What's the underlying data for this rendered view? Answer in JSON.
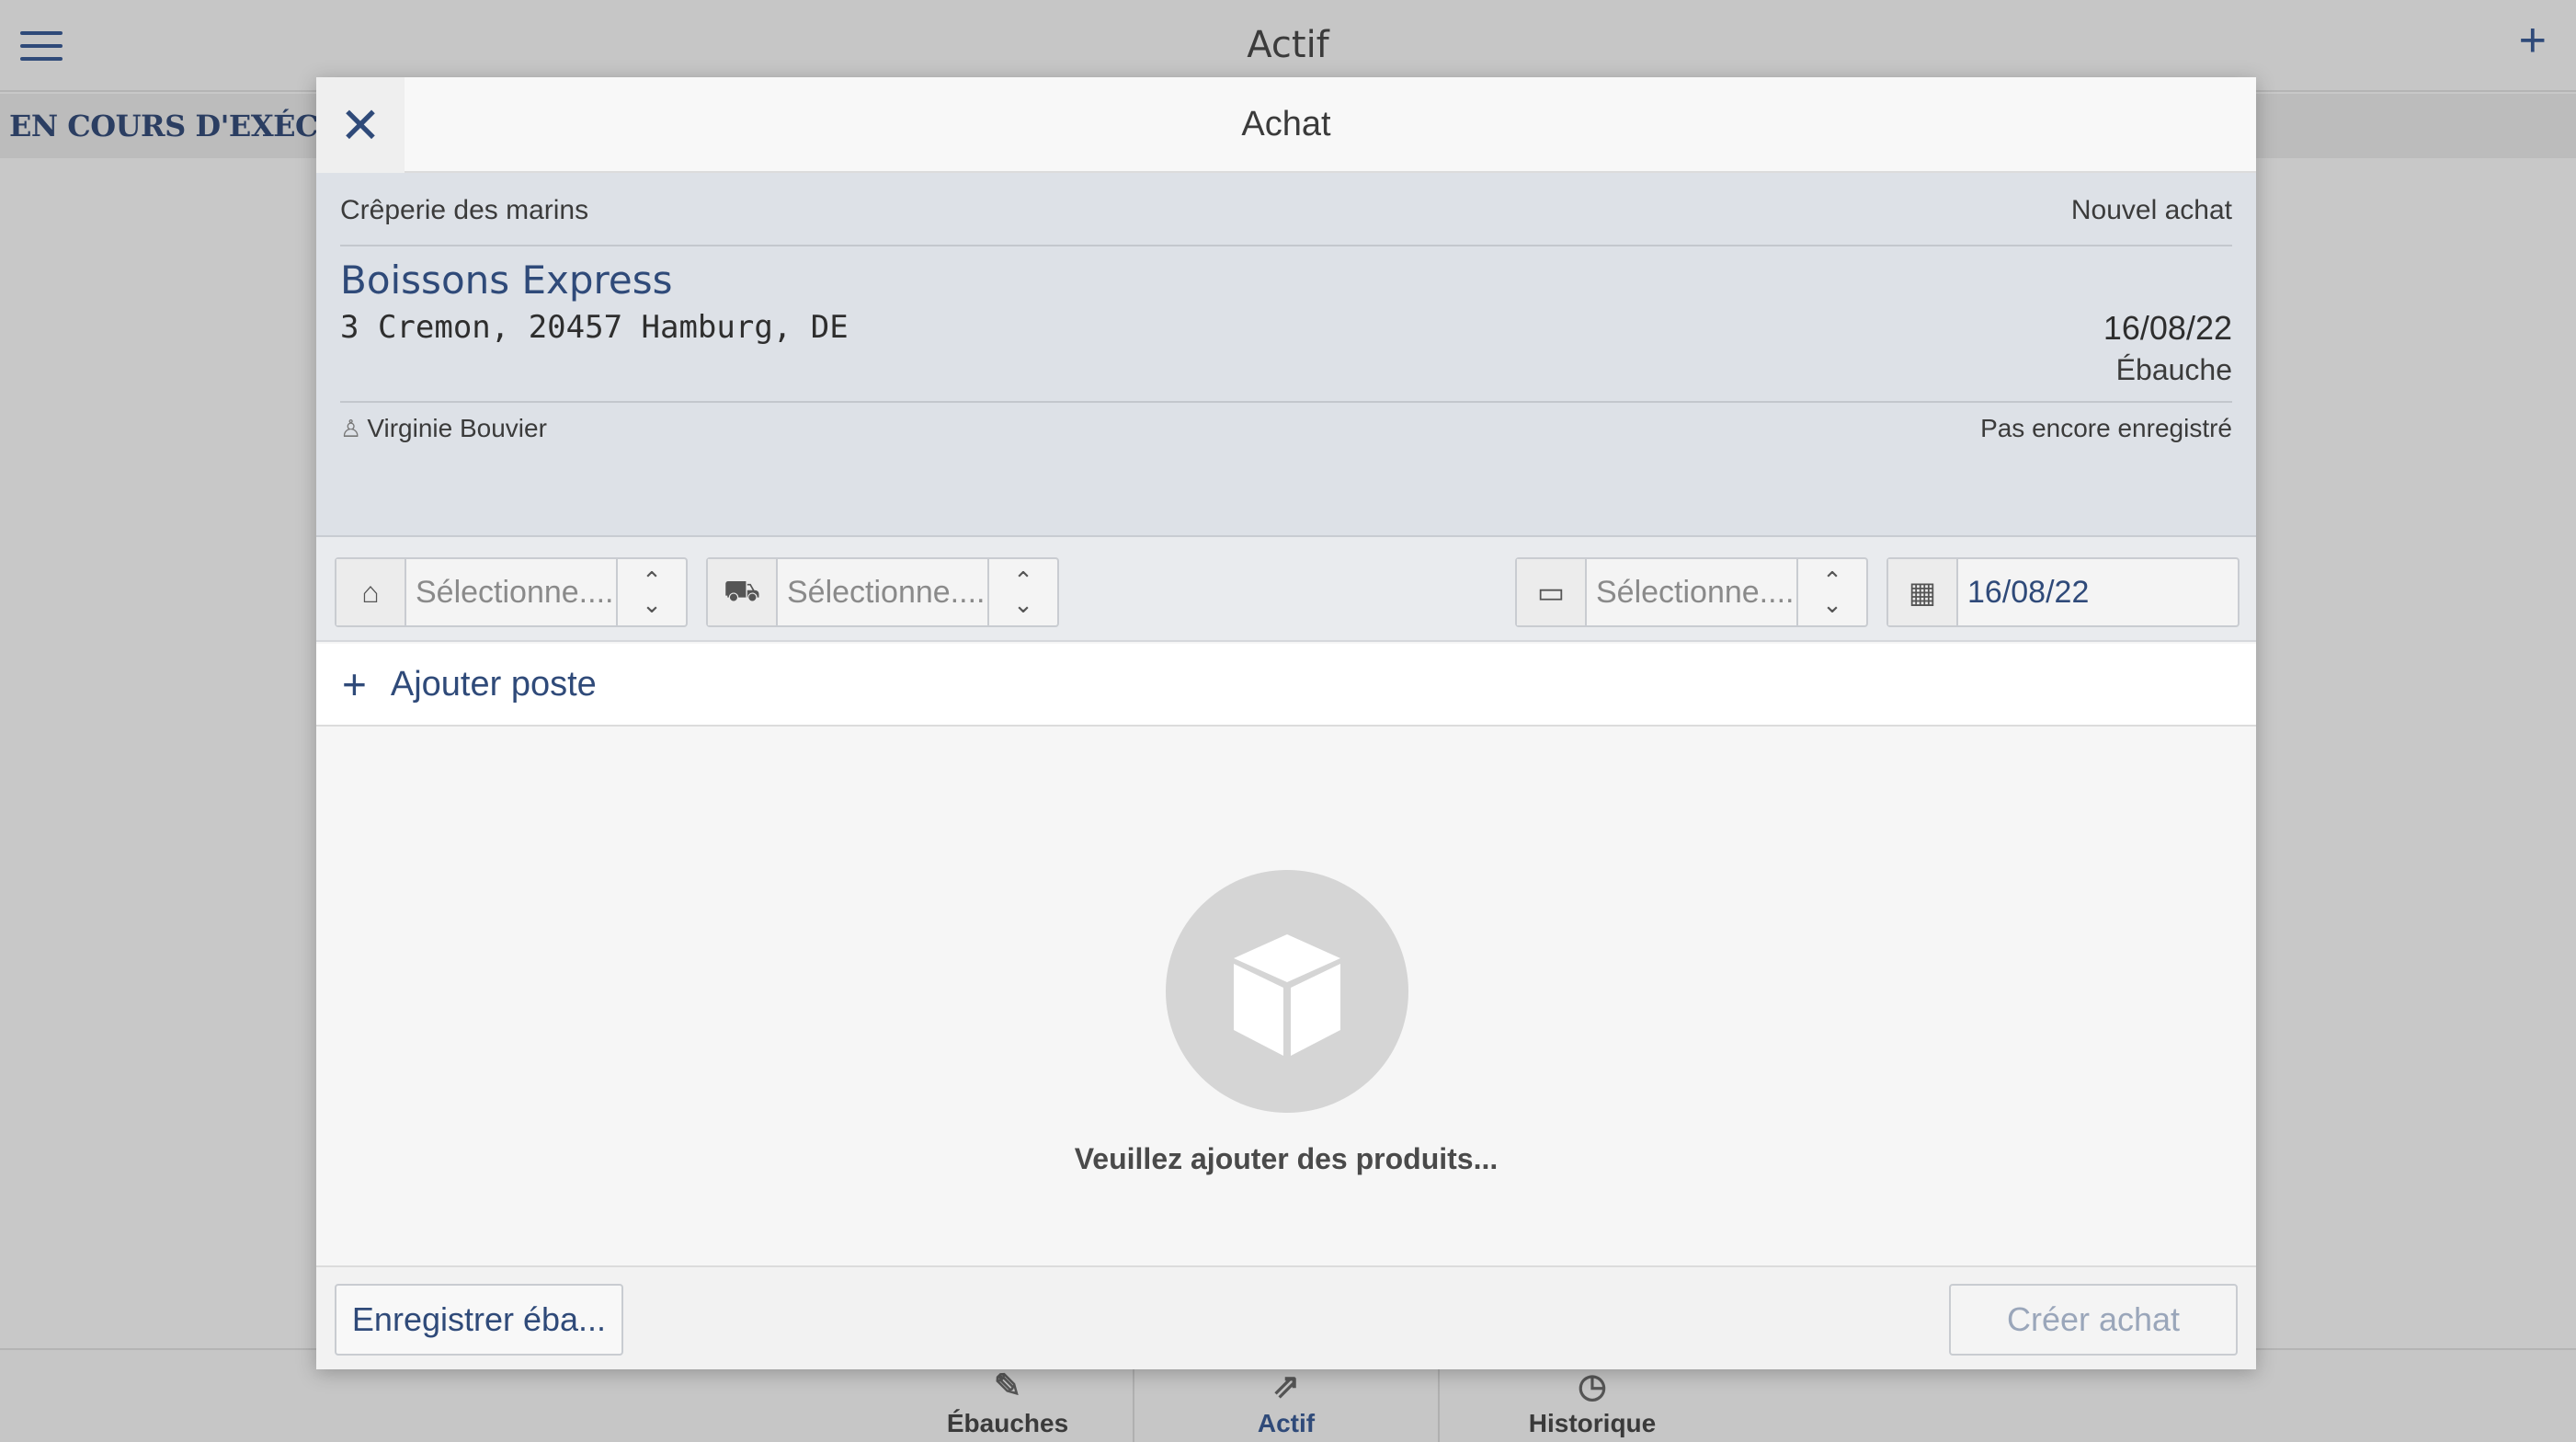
{
  "app": {
    "title": "Actif",
    "section_label": "EN COURS D'EXÉCUTION",
    "menu_icon": "hamburger-icon",
    "add_icon": "plus-icon"
  },
  "bottom_tabs": [
    {
      "label": "Ébauches",
      "icon": "drafts-icon",
      "active": false
    },
    {
      "label": "Actif",
      "icon": "active-icon",
      "active": true
    },
    {
      "label": "Historique",
      "icon": "history-icon",
      "active": false
    }
  ],
  "modal": {
    "title": "Achat",
    "close_icon": "close-icon",
    "info": {
      "shop": "Crêperie des marins",
      "purchase_type": "Nouvel achat",
      "supplier": "Boissons Express",
      "address": "3 Cremon, 20457 Hamburg, DE",
      "date": "16/08/22",
      "status": "Ébauche",
      "user": "Virginie Bouvier",
      "save_status": "Pas encore enregistré"
    },
    "selectors": [
      {
        "placeholder": "Sélectionne.....",
        "icon": "warehouse-icon"
      },
      {
        "placeholder": "Sélectionne.....",
        "icon": "delivery-icon"
      },
      {
        "placeholder": "Sélectionne.....",
        "icon": "payment-icon"
      }
    ],
    "date_field": {
      "value": "16/08/22",
      "icon": "calendar-icon"
    },
    "add_item_label": "Ajouter poste",
    "empty_message": "Veuillez ajouter des produits...",
    "buttons": {
      "save_draft": "Enregistrer éba...",
      "create": "Créer achat"
    }
  },
  "colors": {
    "accent": "#2f4a79",
    "info_bg": "#dde1e7",
    "overlay_bg": "#c8c8c8"
  }
}
